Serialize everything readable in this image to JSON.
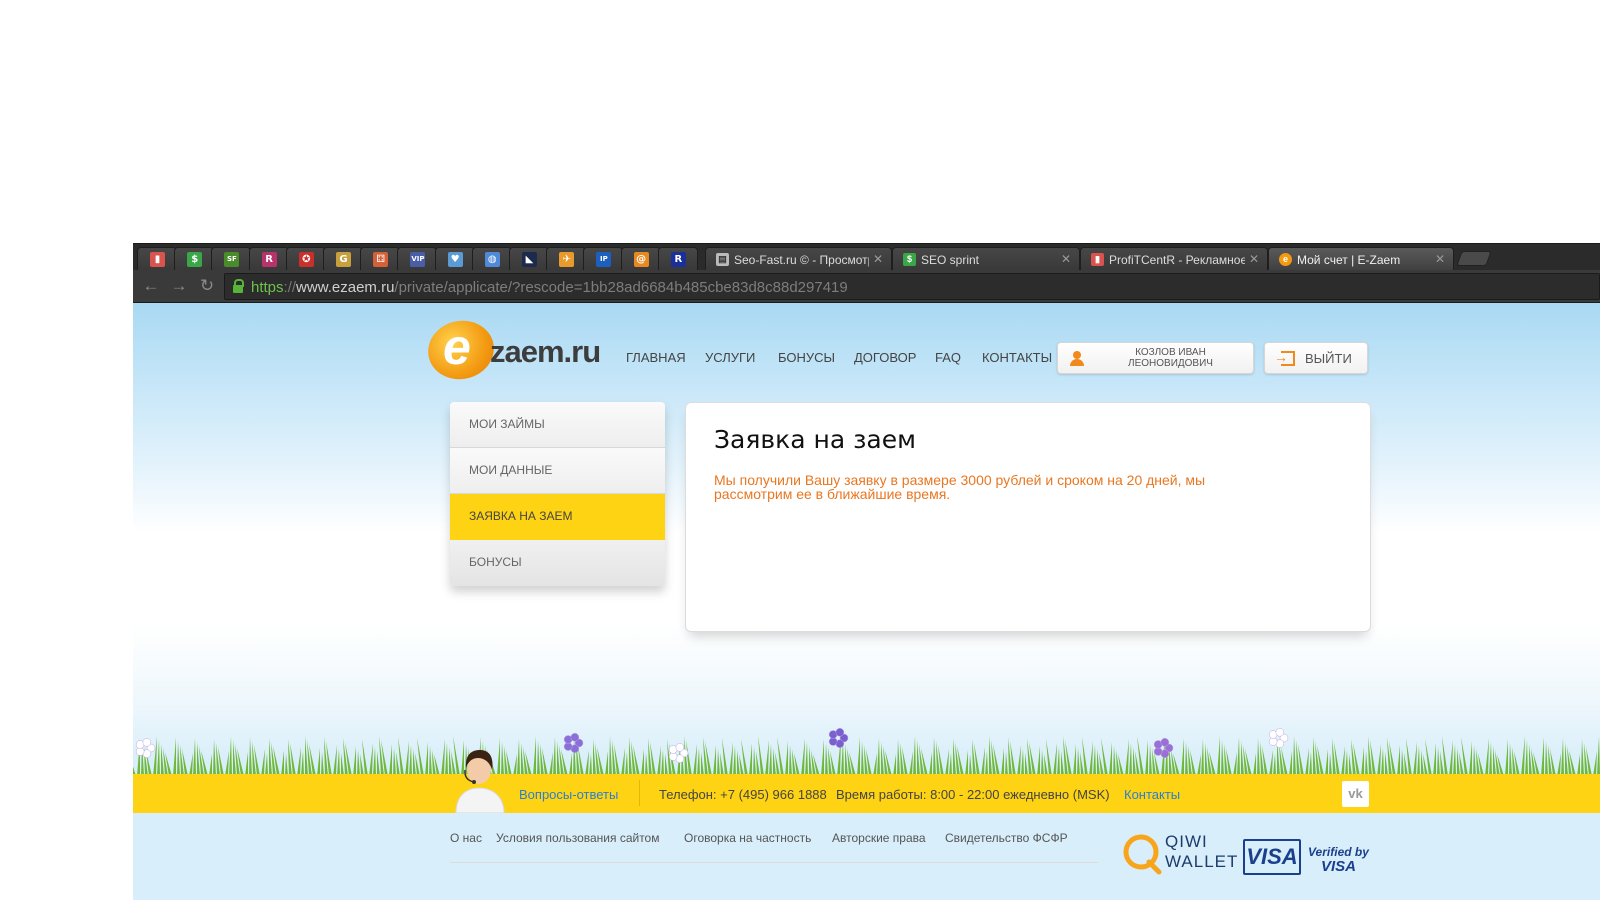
{
  "browser": {
    "pinned_tabs": [
      {
        "icon": "bar-chart-icon",
        "glyph": "▮",
        "color": "#d9534f"
      },
      {
        "icon": "seo-sprint-icon",
        "glyph": "$",
        "color": "#3aa648"
      },
      {
        "icon": "sf-icon",
        "glyph": "SF",
        "color": "#4b8c2a"
      },
      {
        "icon": "r-letter-icon",
        "glyph": "R",
        "color": "#b8336a"
      },
      {
        "icon": "emblem-icon",
        "glyph": "✪",
        "color": "#c9302c"
      },
      {
        "icon": "g-icon",
        "glyph": "G",
        "color": "#c7a03d"
      },
      {
        "icon": "game-icon",
        "glyph": "⚃",
        "color": "#d4603a"
      },
      {
        "icon": "vip-icon",
        "glyph": "VIP",
        "color": "#4a5ea8"
      },
      {
        "icon": "heart-icon",
        "glyph": "♥",
        "color": "#5b9bd5"
      },
      {
        "icon": "globe-icon",
        "glyph": "◍",
        "color": "#4f8ad8"
      },
      {
        "icon": "chart-line-icon",
        "glyph": "◣",
        "color": "#1c2b4d"
      },
      {
        "icon": "plane-icon",
        "glyph": "✈",
        "color": "#e89b2a"
      },
      {
        "icon": "ip-icon",
        "glyph": "IP",
        "color": "#1d5fbf"
      },
      {
        "icon": "mail-at-icon",
        "glyph": "@",
        "color": "#e8891f"
      },
      {
        "icon": "r-box-icon",
        "glyph": "R",
        "color": "#1b2f9a"
      }
    ],
    "tabs": [
      {
        "title": "Seo-Fast.ru © - Просмотр",
        "icon": "page-icon",
        "glyph": "▤",
        "color": "#bbbbbb"
      },
      {
        "title": "SEO sprint",
        "icon": "seo-sprint-icon",
        "glyph": "$",
        "color": "#3aa648"
      },
      {
        "title": "ProfiTCentR - Рекламное",
        "icon": "bar-chart-icon",
        "glyph": "▮",
        "color": "#d9534f"
      },
      {
        "title": "Мой счет | E-Zaem",
        "icon": "ezaem-icon",
        "glyph": "e",
        "color": "#f39a12"
      }
    ],
    "close_glyph": "✕",
    "nav": {
      "back": "←",
      "forward": "→",
      "reload": "↻"
    },
    "url": {
      "scheme": "https",
      "sep": "://",
      "host": "www.ezaem.ru",
      "path": "/private/applicate/?rescode=1bb28ad6684b485cbe83d8c88d297419"
    }
  },
  "site": {
    "logo": {
      "e": "e",
      "rest": "zaem.ru"
    },
    "nav": [
      "ГЛАВНАЯ",
      "УСЛУГИ",
      "БОНУСЫ",
      "ДОГОВОР",
      "FAQ",
      "КОНТАКТЫ"
    ],
    "user": {
      "line1": "КОЗЛОВ ИВАН",
      "line2": "ЛЕОНОВИДОВИЧ"
    },
    "logout": "ВЫЙТИ",
    "menu": [
      {
        "label": "МОИ ЗАЙМЫ",
        "active": false
      },
      {
        "label": "МОИ ДАННЫЕ",
        "active": false
      },
      {
        "label": "ЗАЯВКА НА ЗАЕМ",
        "active": true
      },
      {
        "label": "БОНУСЫ",
        "active": false
      }
    ],
    "content": {
      "title": "Заявка на заем",
      "message_line1": "Мы получили Вашу заявку в размере 3000 рублей и сроком на 20 дней, мы",
      "message_line2": "рассмотрим ее в ближайшие время."
    },
    "footer_bar": {
      "faq_link": "Вопросы-ответы",
      "phone": "Телефон: +7 (495) 966 1888",
      "hours": "Время работы:  8:00 - 22:00 ежедневно (MSK)",
      "contacts_link": "Контакты",
      "vk": "vk"
    },
    "bottom_links": [
      "О нас",
      "Условия пользования сайтом",
      "Оговорка на частность",
      "Авторские права",
      "Свидетельство ФСФР"
    ],
    "payments": {
      "qiwi_top": "QIWI",
      "qiwi_bottom": "WALLET",
      "visa": "VISA",
      "verified_top": "Verified by",
      "verified_bottom": "VISA"
    },
    "colors": {
      "accent_orange": "#e87722",
      "yellow": "#fed313",
      "link": "#2a7fd1"
    }
  }
}
